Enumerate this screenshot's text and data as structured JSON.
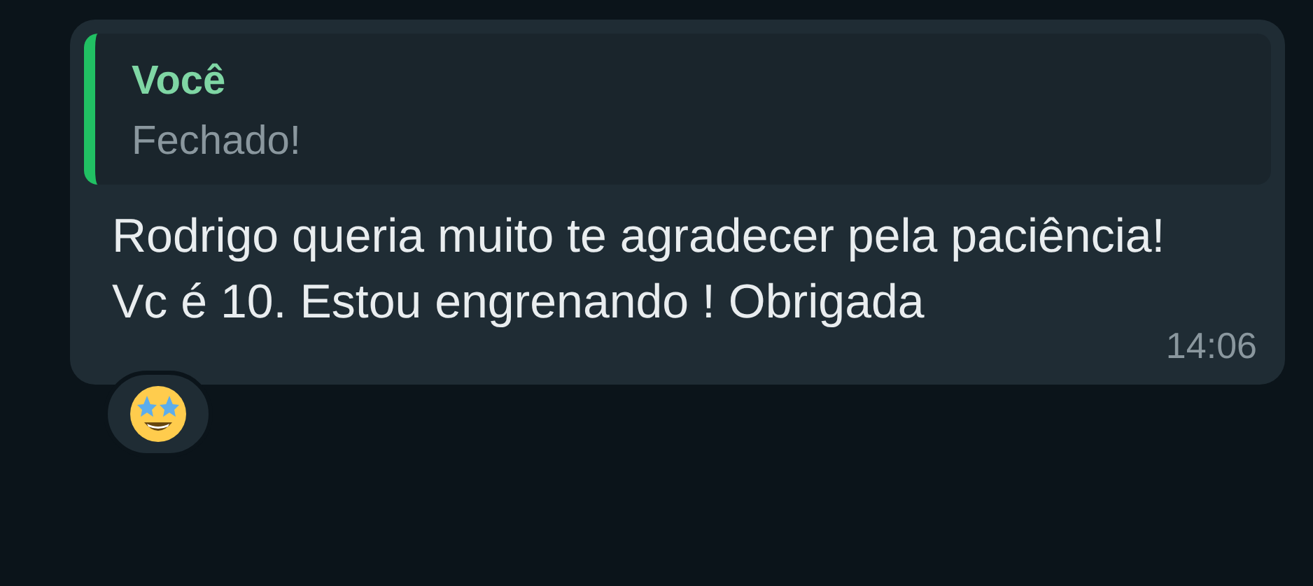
{
  "message": {
    "quote": {
      "author": "Você",
      "text": "Fechado!"
    },
    "text": "Rodrigo queria muito te agradecer pela paciência! Vc é 10. Estou engrenando ! Obrigada",
    "time": "14:06"
  },
  "reaction": {
    "kind": "star_struck"
  }
}
